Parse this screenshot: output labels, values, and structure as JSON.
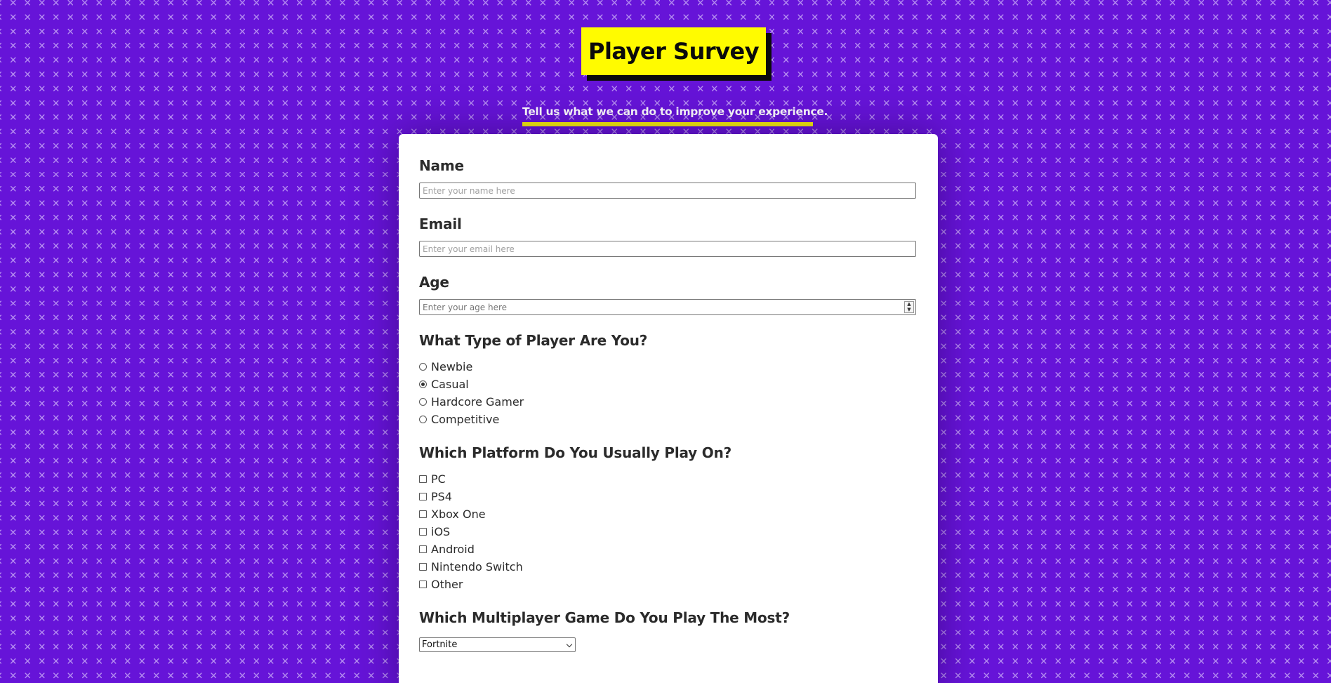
{
  "header": {
    "title": "Player Survey",
    "description": "Tell us what we can do to improve your experience."
  },
  "colors": {
    "background": "#6614d8",
    "accent": "#fffb00",
    "card": "#ffffff"
  },
  "form": {
    "name": {
      "label": "Name",
      "placeholder": "Enter your name here",
      "value": ""
    },
    "email": {
      "label": "Email",
      "placeholder": "Enter your email here",
      "value": ""
    },
    "age": {
      "label": "Age",
      "placeholder": "Enter your age here",
      "value": ""
    },
    "player_type": {
      "label": "What Type of Player Are You?",
      "options": [
        {
          "label": "Newbie",
          "checked": false
        },
        {
          "label": "Casual",
          "checked": true
        },
        {
          "label": "Hardcore Gamer",
          "checked": false
        },
        {
          "label": "Competitive",
          "checked": false
        }
      ]
    },
    "platform": {
      "label": "Which Platform Do You Usually Play On?",
      "options": [
        {
          "label": "PC",
          "checked": false
        },
        {
          "label": "PS4",
          "checked": false
        },
        {
          "label": "Xbox One",
          "checked": false
        },
        {
          "label": "iOS",
          "checked": false
        },
        {
          "label": "Android",
          "checked": false
        },
        {
          "label": "Nintendo Switch",
          "checked": false
        },
        {
          "label": "Other",
          "checked": false
        }
      ]
    },
    "game": {
      "label": "Which Multiplayer Game Do You Play The Most?",
      "selected": "Fortnite"
    }
  }
}
